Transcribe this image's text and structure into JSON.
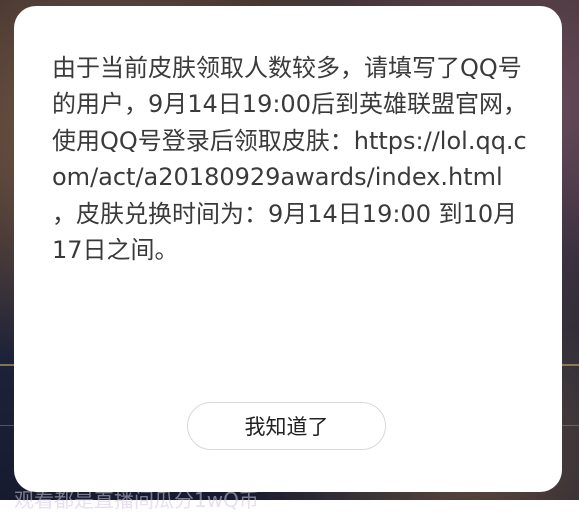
{
  "dialog": {
    "message": "由于当前皮肤领取人数较多，请填写了QQ号的用户，9月14日19:00后到英雄联盟官网，使用QQ号登录后领取皮肤：https://lol.qq.com/act/a20180929awards/index.html ，皮肤兑换时间为：9月14日19:00 到10月17日之间。",
    "confirm_label": "我知道了"
  },
  "background": {
    "partial_text": "观看都是直播间瓜分1wQ币"
  },
  "colors": {
    "dialog_bg": "#ffffff",
    "message_text": "#3a3a3a",
    "button_border": "#d9d9d9"
  }
}
